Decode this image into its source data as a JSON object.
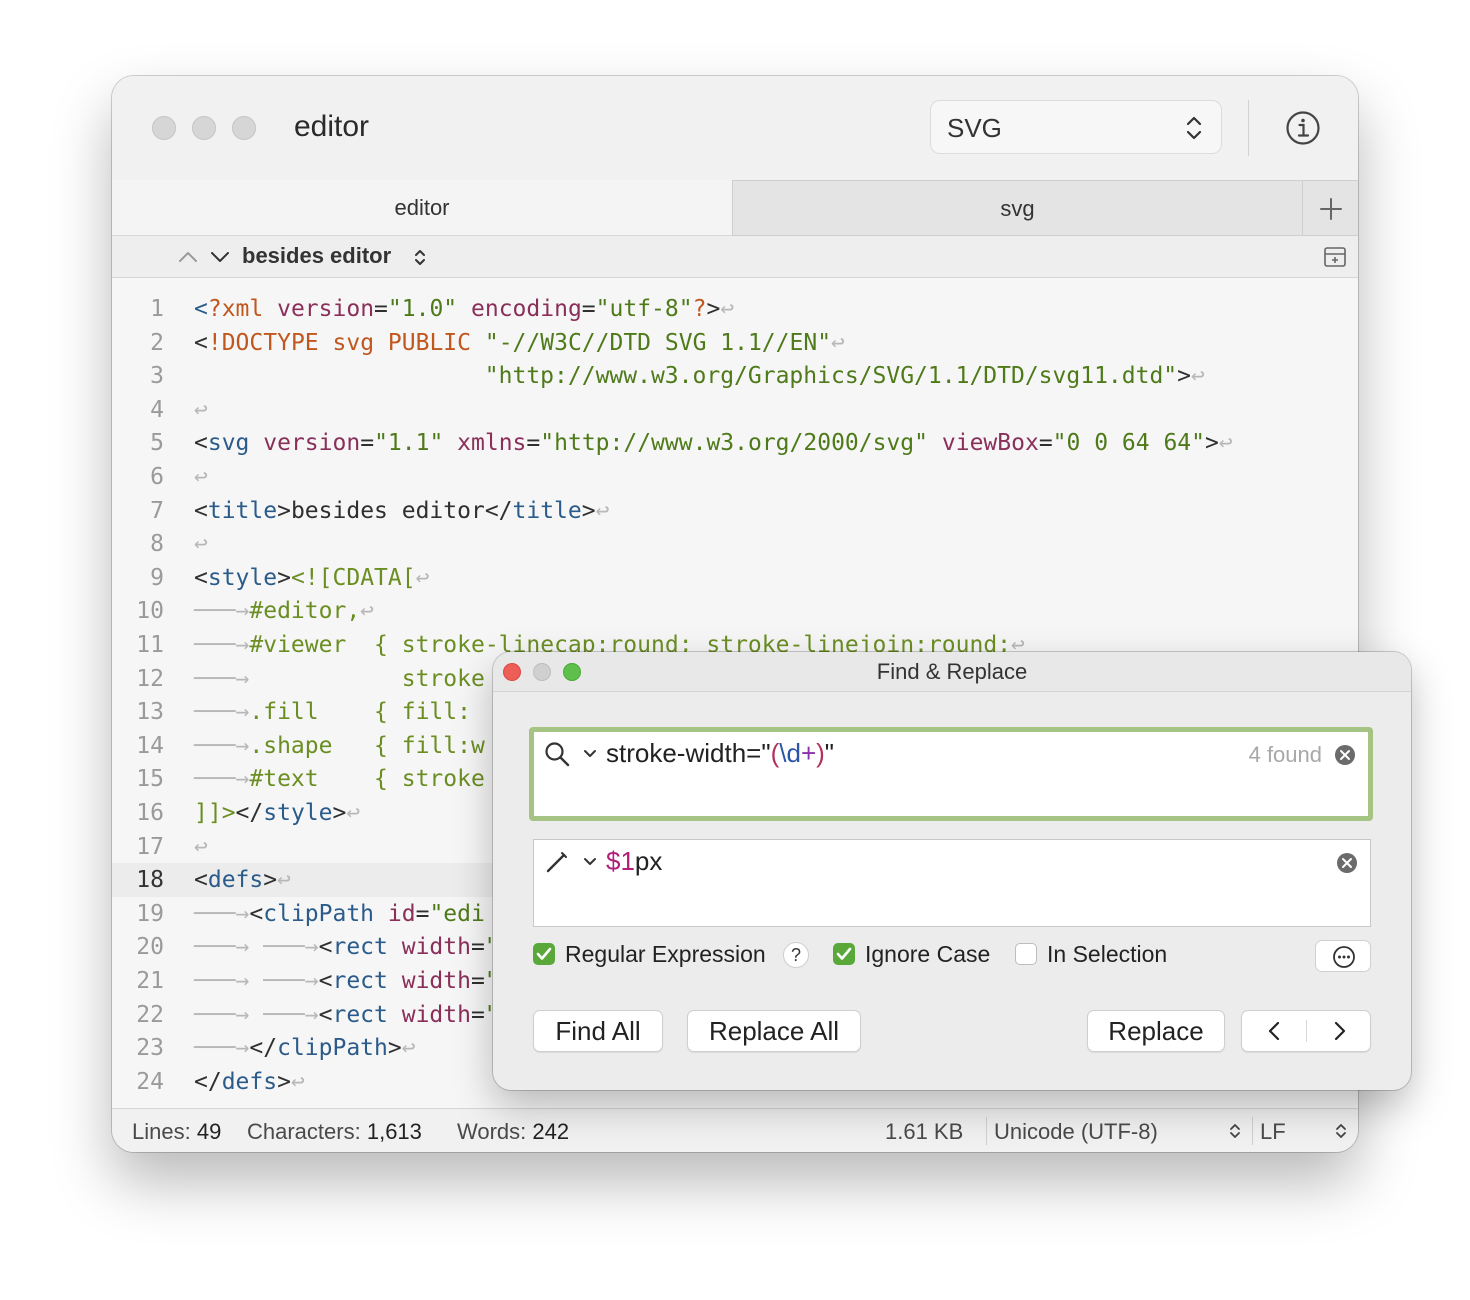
{
  "window": {
    "title": "editor",
    "syntax_selector": "SVG",
    "tabs": [
      {
        "label": "editor",
        "active": true
      },
      {
        "label": "svg",
        "active": false
      }
    ],
    "outline_label": "besides editor"
  },
  "editor": {
    "current_line": 18,
    "lines": [
      {
        "n": "1",
        "html": "<span class=\"tag\">&lt;</span><span class=\"kw\">?xml</span> <span class=\"attr\">version</span>=<span class=\"str\">\"1.0\"</span> <span class=\"attr\">encoding</span>=<span class=\"str\">\"utf-8\"</span><span class=\"kw\">?</span>&gt;<span class=\"inv\">↩</span>"
      },
      {
        "n": "2",
        "html": "&lt;<span class=\"kw\">!DOCTYPE</span> <span class=\"kw\">svg</span> <span class=\"kw\">PUBLIC</span> <span class=\"str\">\"-//W3C//DTD SVG 1.1//EN\"</span><span class=\"inv\">↩</span>"
      },
      {
        "n": "3",
        "html": "                     <span class=\"str\">\"http://www.w3.org/Graphics/SVG/1.1/DTD/svg11.dtd\"</span>&gt;<span class=\"inv\">↩</span>"
      },
      {
        "n": "4",
        "html": "<span class=\"inv\">↩</span>"
      },
      {
        "n": "5",
        "html": "&lt;<span class=\"tag\">svg</span> <span class=\"attr\">version</span>=<span class=\"str\">\"1.1\"</span> <span class=\"attr\">xmlns</span>=<span class=\"str\">\"http://www.w3.org/2000/svg\"</span> <span class=\"attr\">viewBox</span>=<span class=\"str\">\"0 0 64 64\"</span>&gt;<span class=\"inv\">↩</span>"
      },
      {
        "n": "6",
        "html": "<span class=\"inv\">↩</span>"
      },
      {
        "n": "7",
        "html": "&lt;<span class=\"tag\">title</span>&gt;besides editor&lt;/<span class=\"tag\">title</span>&gt;<span class=\"inv\">↩</span>"
      },
      {
        "n": "8",
        "html": "<span class=\"inv\">↩</span>"
      },
      {
        "n": "9",
        "html": "&lt;<span class=\"tag\">style</span>&gt;<span class=\"sel\">&lt;![CDATA[</span><span class=\"inv\">↩</span>"
      },
      {
        "n": "10",
        "html": "<span class=\"inv\">───→</span><span class=\"sel\">#editor,</span><span class=\"inv\">↩</span>"
      },
      {
        "n": "11",
        "html": "<span class=\"inv\">───→</span><span class=\"sel\">#viewer</span>  <span class=\"sel\">{</span> <span class=\"sel\">stroke-linecap:round; stroke-linejoin:round;</span><span class=\"inv\">↩</span>"
      },
      {
        "n": "12",
        "html": "<span class=\"inv\">───→</span>           <span class=\"sel\">stroke</span>"
      },
      {
        "n": "13",
        "html": "<span class=\"inv\">───→</span><span class=\"sel\">.fill</span>    <span class=\"sel\">{ fill:</span>"
      },
      {
        "n": "14",
        "html": "<span class=\"inv\">───→</span><span class=\"sel\">.shape</span>   <span class=\"sel\">{ fill:w</span>"
      },
      {
        "n": "15",
        "html": "<span class=\"inv\">───→</span><span class=\"sel\">#text</span>    <span class=\"sel\">{ stroke</span>"
      },
      {
        "n": "16",
        "html": "<span class=\"sel\">]]&gt;</span>&lt;/<span class=\"tag\">style</span>&gt;<span class=\"inv\">↩</span>"
      },
      {
        "n": "17",
        "html": "<span class=\"inv\">↩</span>"
      },
      {
        "n": "18",
        "html": "&lt;<span class=\"tag\">defs</span>&gt;<span class=\"inv\">↩</span>"
      },
      {
        "n": "19",
        "html": "<span class=\"inv\">───→</span>&lt;<span class=\"tag\">clipPath</span> <span class=\"attr\">id</span>=<span class=\"str\">\"edi</span>"
      },
      {
        "n": "20",
        "html": "<span class=\"inv\">───→ ───→</span>&lt;<span class=\"tag\">rect</span> <span class=\"attr\">width</span>=<span class=\"str\">\"</span>"
      },
      {
        "n": "21",
        "html": "<span class=\"inv\">───→ ───→</span>&lt;<span class=\"tag\">rect</span> <span class=\"attr\">width</span>=<span class=\"str\">\"</span>"
      },
      {
        "n": "22",
        "html": "<span class=\"inv\">───→ ───→</span>&lt;<span class=\"tag\">rect</span> <span class=\"attr\">width</span>=<span class=\"str\">\"</span>"
      },
      {
        "n": "23",
        "html": "<span class=\"inv\">───→</span>&lt;/<span class=\"tag\">clipPath</span>&gt;<span class=\"inv\">↩</span>"
      },
      {
        "n": "24",
        "html": "&lt;/<span class=\"tag\">defs</span>&gt;<span class=\"inv\">↩</span>"
      }
    ]
  },
  "status": {
    "lines_label": "Lines:",
    "lines_value": "49",
    "chars_label": "Characters:",
    "chars_value": "1,613",
    "words_label": "Words:",
    "words_value": "242",
    "size": "1.61 KB",
    "encoding": "Unicode (UTF-8)",
    "line_ending": "LF"
  },
  "find_panel": {
    "title": "Find & Replace",
    "find_parts": [
      "stroke-width=\"",
      "(",
      "\\d",
      "+",
      ")",
      "\""
    ],
    "found_count": "4 found",
    "replace_parts": [
      "$1",
      "px"
    ],
    "options": [
      {
        "label": "Regular Expression",
        "checked": true
      },
      {
        "label": "Ignore Case",
        "checked": true
      },
      {
        "label": "In Selection",
        "checked": false
      }
    ],
    "help_label": "?",
    "buttons": {
      "find_all": "Find All",
      "replace_all": "Replace All",
      "replace": "Replace"
    }
  },
  "colors": {
    "find_focus_border": "#a5c483",
    "checkbox_on": "#5aa83a",
    "close_red": "#ee5e56",
    "zoom_green": "#5ec04a"
  }
}
